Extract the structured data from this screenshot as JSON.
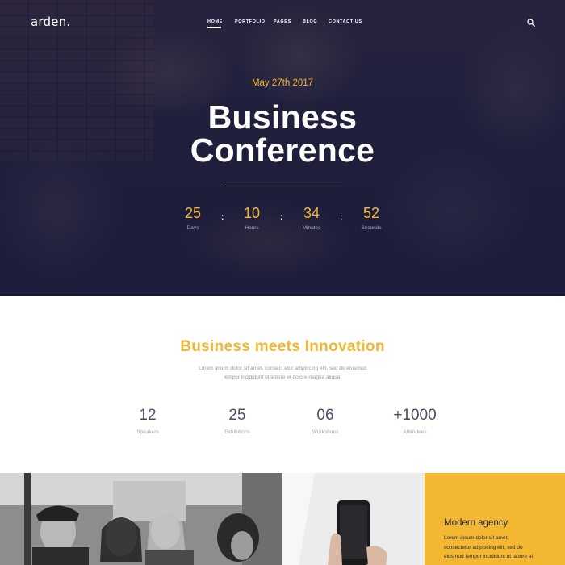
{
  "brand": {
    "logo": "arden."
  },
  "nav": {
    "items": [
      {
        "label": "HOME",
        "active": true
      },
      {
        "label": "PORTFOLIO",
        "active": false
      },
      {
        "label": "PAGES",
        "active": false
      },
      {
        "label": "BLOG",
        "active": false
      },
      {
        "label": "CONTACT US",
        "active": false
      }
    ],
    "search_icon": "search-icon"
  },
  "hero": {
    "date": "May 27th 2017",
    "title_line1": "Business",
    "title_line2": "Conference",
    "countdown": [
      {
        "value": "25",
        "label": "Days"
      },
      {
        "value": "10",
        "label": "Hours"
      },
      {
        "value": "34",
        "label": "Minutes"
      },
      {
        "value": "52",
        "label": "Seconds"
      }
    ],
    "separator": ":"
  },
  "intro": {
    "title": "Business meets Innovation",
    "text_line1": "Lorem ipsum dolor sit amet, consect etur adipiscing elit, sed do eiusmod",
    "text_line2": "tempor incididunt ut labore et dolore magna aliqua.",
    "stats": [
      {
        "value": "12",
        "label": "Speakers"
      },
      {
        "value": "25",
        "label": "Exhibitions"
      },
      {
        "value": "06",
        "label": "Workshops"
      },
      {
        "value": "+1000",
        "label": "Attendees"
      }
    ]
  },
  "promo": {
    "title": "Modern agency",
    "text_line1": "Lorem ipsum dolor sit amet,",
    "text_line2": "consectetur adipiscing elit, sed do",
    "text_line3": "eiusmod tempor incididunt ut labore et"
  },
  "colors": {
    "accent": "#f3b731",
    "hero_overlay": "#181a3c",
    "stat_text": "#4a4e63"
  }
}
